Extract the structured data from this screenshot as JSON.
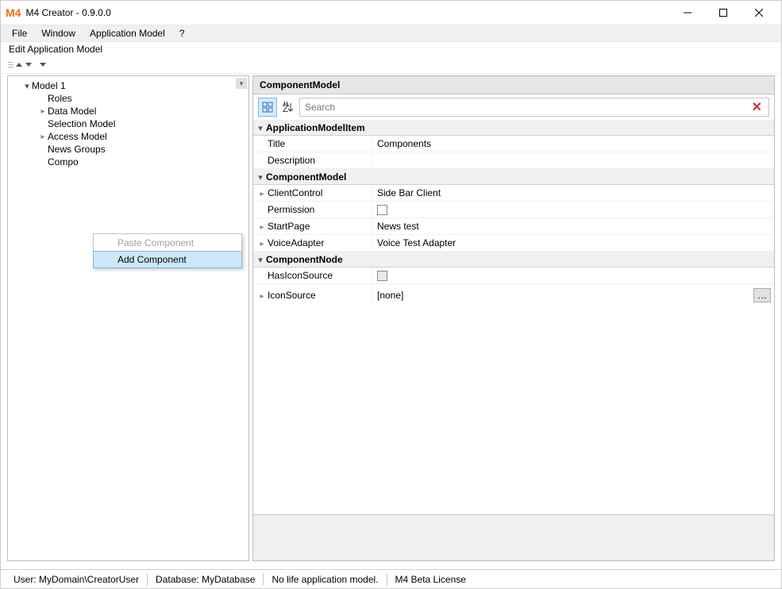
{
  "window": {
    "title": "M4 Creator - 0.9.0.0",
    "app_icon_text": "M4"
  },
  "menu": {
    "file": "File",
    "window": "Window",
    "app_model": "Application Model",
    "help": "?"
  },
  "panel": {
    "title": "Edit Application Model"
  },
  "tree": {
    "root": "Model 1",
    "items": [
      {
        "label": "Roles",
        "expander": "none"
      },
      {
        "label": "Data Model",
        "expander": "right"
      },
      {
        "label": "Selection Model",
        "expander": "none"
      },
      {
        "label": "Access Model",
        "expander": "right"
      },
      {
        "label": "News Groups",
        "expander": "none"
      },
      {
        "label": "Compo",
        "expander": "none"
      }
    ]
  },
  "context_menu": {
    "paste": "Paste Component",
    "add": "Add Component"
  },
  "property_grid": {
    "header": "ComponentModel",
    "search_placeholder": "Search",
    "sections": [
      {
        "name": "ApplicationModelItem",
        "rows": [
          {
            "key": "Title",
            "val": "Components",
            "expander": ""
          },
          {
            "key": "Description",
            "val": "",
            "expander": ""
          }
        ]
      },
      {
        "name": "ComponentModel",
        "rows": [
          {
            "key": "ClientControl",
            "val": "Side Bar Client",
            "expander": "right"
          },
          {
            "key": "Permission",
            "val": "",
            "expander": "",
            "checkbox": true
          },
          {
            "key": "StartPage",
            "val": "News test",
            "expander": "right"
          },
          {
            "key": "VoiceAdapter",
            "val": "Voice Test Adapter",
            "expander": "right"
          }
        ]
      },
      {
        "name": "ComponentNode",
        "rows": [
          {
            "key": "HasIconSource",
            "val": "",
            "expander": "",
            "checkbox_gray": true
          }
        ]
      }
    ],
    "iconsource": {
      "key": "IconSource",
      "val": "[none]"
    }
  },
  "status": {
    "user": "User: MyDomain\\CreatorUser",
    "database": "Database: MyDatabase",
    "life": "No life application model.",
    "license": "M4 Beta License"
  }
}
